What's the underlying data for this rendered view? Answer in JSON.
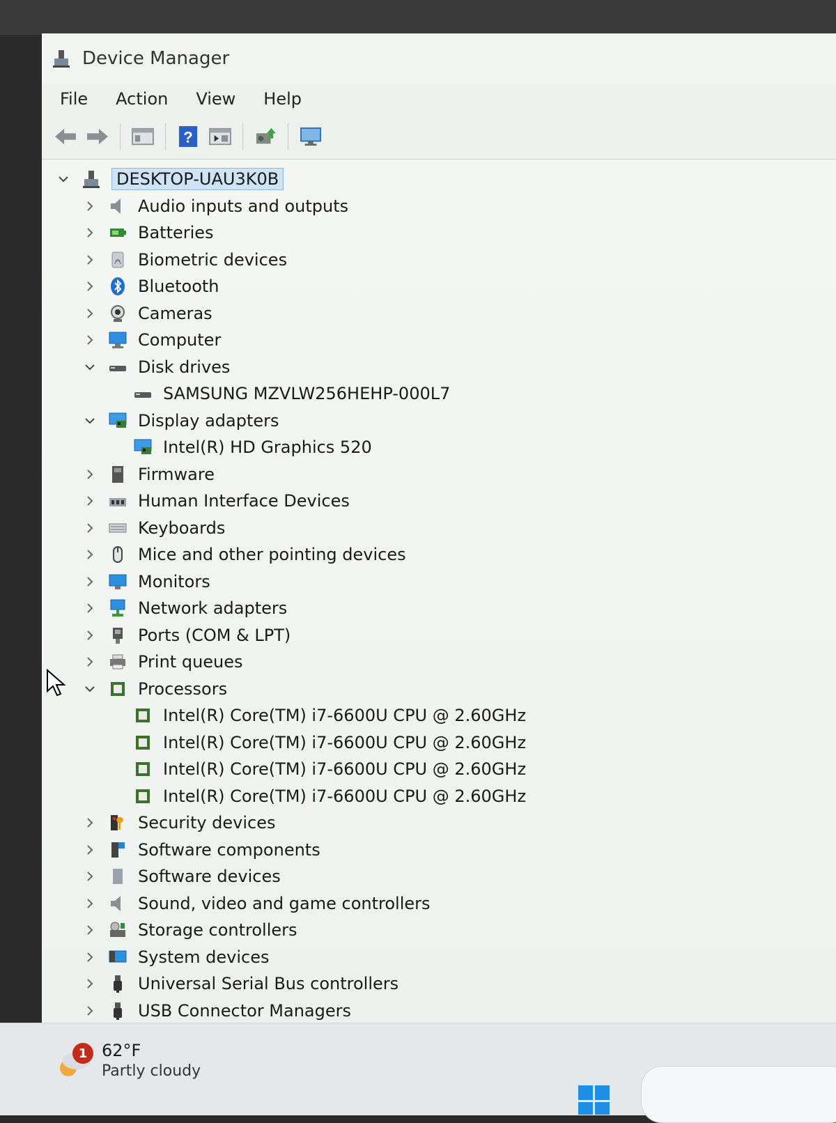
{
  "window": {
    "title": "Device Manager"
  },
  "menu": [
    "File",
    "Action",
    "View",
    "Help"
  ],
  "toolbar": [
    "back-icon",
    "forward-icon",
    "properties-icon",
    "help-icon",
    "update-driver-icon",
    "scan-hardware-icon",
    "monitor-icon"
  ],
  "tree": {
    "root": "DESKTOP-UAU3K0B",
    "items": [
      {
        "label": "Audio inputs and outputs",
        "icon": "speaker-icon",
        "expanded": false
      },
      {
        "label": "Batteries",
        "icon": "battery-icon",
        "expanded": false
      },
      {
        "label": "Biometric devices",
        "icon": "fingerprint-icon",
        "expanded": false
      },
      {
        "label": "Bluetooth",
        "icon": "bluetooth-icon",
        "expanded": false
      },
      {
        "label": "Cameras",
        "icon": "camera-icon",
        "expanded": false
      },
      {
        "label": "Computer",
        "icon": "computer-icon",
        "expanded": false
      },
      {
        "label": "Disk drives",
        "icon": "disk-icon",
        "expanded": true,
        "children": [
          "SAMSUNG MZVLW256HEHP-000L7"
        ]
      },
      {
        "label": "Display adapters",
        "icon": "display-adapter-icon",
        "expanded": true,
        "children": [
          "Intel(R) HD Graphics 520"
        ]
      },
      {
        "label": "Firmware",
        "icon": "firmware-icon",
        "expanded": false
      },
      {
        "label": "Human Interface Devices",
        "icon": "hid-icon",
        "expanded": false
      },
      {
        "label": "Keyboards",
        "icon": "keyboard-icon",
        "expanded": false
      },
      {
        "label": "Mice and other pointing devices",
        "icon": "mouse-icon",
        "expanded": false
      },
      {
        "label": "Monitors",
        "icon": "monitor-icon",
        "expanded": false
      },
      {
        "label": "Network adapters",
        "icon": "network-icon",
        "expanded": false
      },
      {
        "label": "Ports (COM & LPT)",
        "icon": "port-icon",
        "expanded": false
      },
      {
        "label": "Print queues",
        "icon": "printer-icon",
        "expanded": false
      },
      {
        "label": "Processors",
        "icon": "processor-icon",
        "expanded": true,
        "children": [
          "Intel(R) Core(TM) i7-6600U CPU @ 2.60GHz",
          "Intel(R) Core(TM) i7-6600U CPU @ 2.60GHz",
          "Intel(R) Core(TM) i7-6600U CPU @ 2.60GHz",
          "Intel(R) Core(TM) i7-6600U CPU @ 2.60GHz"
        ]
      },
      {
        "label": "Security devices",
        "icon": "security-icon",
        "expanded": false
      },
      {
        "label": "Software components",
        "icon": "software-component-icon",
        "expanded": false
      },
      {
        "label": "Software devices",
        "icon": "software-device-icon",
        "expanded": false
      },
      {
        "label": "Sound, video and game controllers",
        "icon": "speaker-icon",
        "expanded": false
      },
      {
        "label": "Storage controllers",
        "icon": "storage-icon",
        "expanded": false
      },
      {
        "label": "System devices",
        "icon": "system-icon",
        "expanded": false
      },
      {
        "label": "Universal Serial Bus controllers",
        "icon": "usb-icon",
        "expanded": false
      },
      {
        "label": "USB Connector Managers",
        "icon": "usb-icon",
        "expanded": false
      }
    ]
  },
  "taskbar": {
    "weather_temp": "62°F",
    "weather_cond": "Partly cloudy",
    "weather_badge": "1"
  },
  "colors": {
    "selection": "#cfe3f5",
    "accent": "#1f6fd1",
    "badge": "#c42b1c"
  }
}
